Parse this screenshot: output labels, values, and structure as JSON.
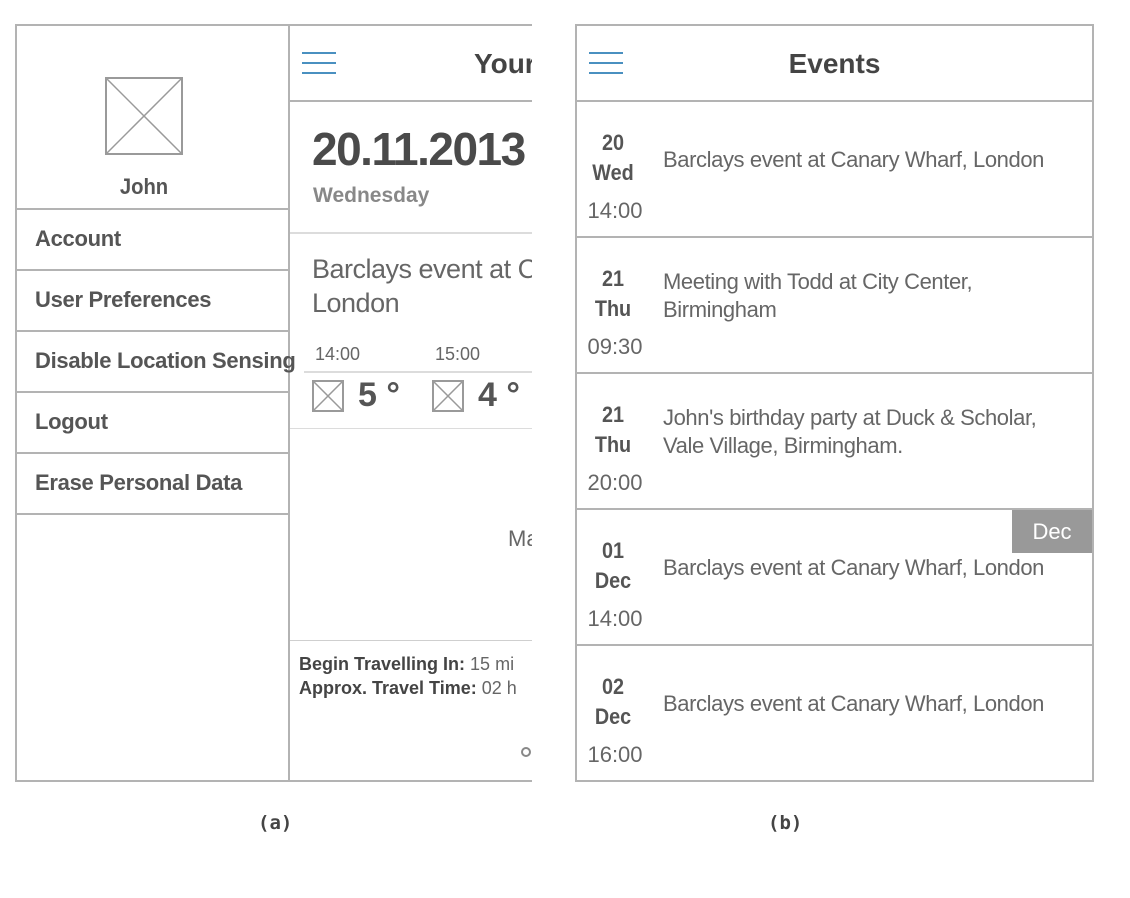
{
  "panel_a": {
    "drawer": {
      "profile_name": "John",
      "menu": [
        {
          "label": "Account"
        },
        {
          "label": "User Preferences"
        },
        {
          "label": "Disable Location Sensing"
        },
        {
          "label": "Logout"
        },
        {
          "label": "Erase Personal Data"
        }
      ]
    },
    "dashboard": {
      "title": "Your",
      "date": "20.11.2013",
      "weekday": "Wednesday",
      "event_line1": "Barclays event at C",
      "event_line2": "London",
      "weather": [
        {
          "time": "14:00",
          "temp": "5 °",
          "icon": "weather-icon"
        },
        {
          "time": "15:00",
          "temp": "4 °",
          "icon": "weather-icon"
        }
      ],
      "map_label": "Ma",
      "begin_travelling_label": "Begin Travelling In:",
      "begin_travelling_value": "15 mi",
      "travel_time_label": "Approx. Travel Time:",
      "travel_time_value": "02 h"
    },
    "caption": "(a)"
  },
  "panel_b": {
    "title": "Events",
    "month_badge": "Dec",
    "events": [
      {
        "day": "20",
        "weekday": "Wed",
        "time": "14:00",
        "text": [
          "Barclays event at Canary Wharf, London"
        ]
      },
      {
        "day": "21",
        "weekday": "Thu",
        "time": "09:30",
        "text": [
          "Meeting  with Todd at City Center,",
          "Birmingham"
        ]
      },
      {
        "day": "21",
        "weekday": "Thu",
        "time": "20:00",
        "text": [
          "John's birthday party at Duck & Scholar,",
          "Vale Village, Birmingham."
        ]
      },
      {
        "day": "01",
        "weekday": "Dec",
        "time": "14:00",
        "text": [
          "Barclays event at Canary Wharf, London"
        ]
      },
      {
        "day": "02",
        "weekday": "Dec",
        "time": "16:00",
        "text": [
          "Barclays event at Canary Wharf, London"
        ]
      }
    ],
    "caption": "(b)"
  },
  "colors": {
    "accent": "#4a90c0",
    "border": "#b3b3b3",
    "badge": "#999999"
  }
}
